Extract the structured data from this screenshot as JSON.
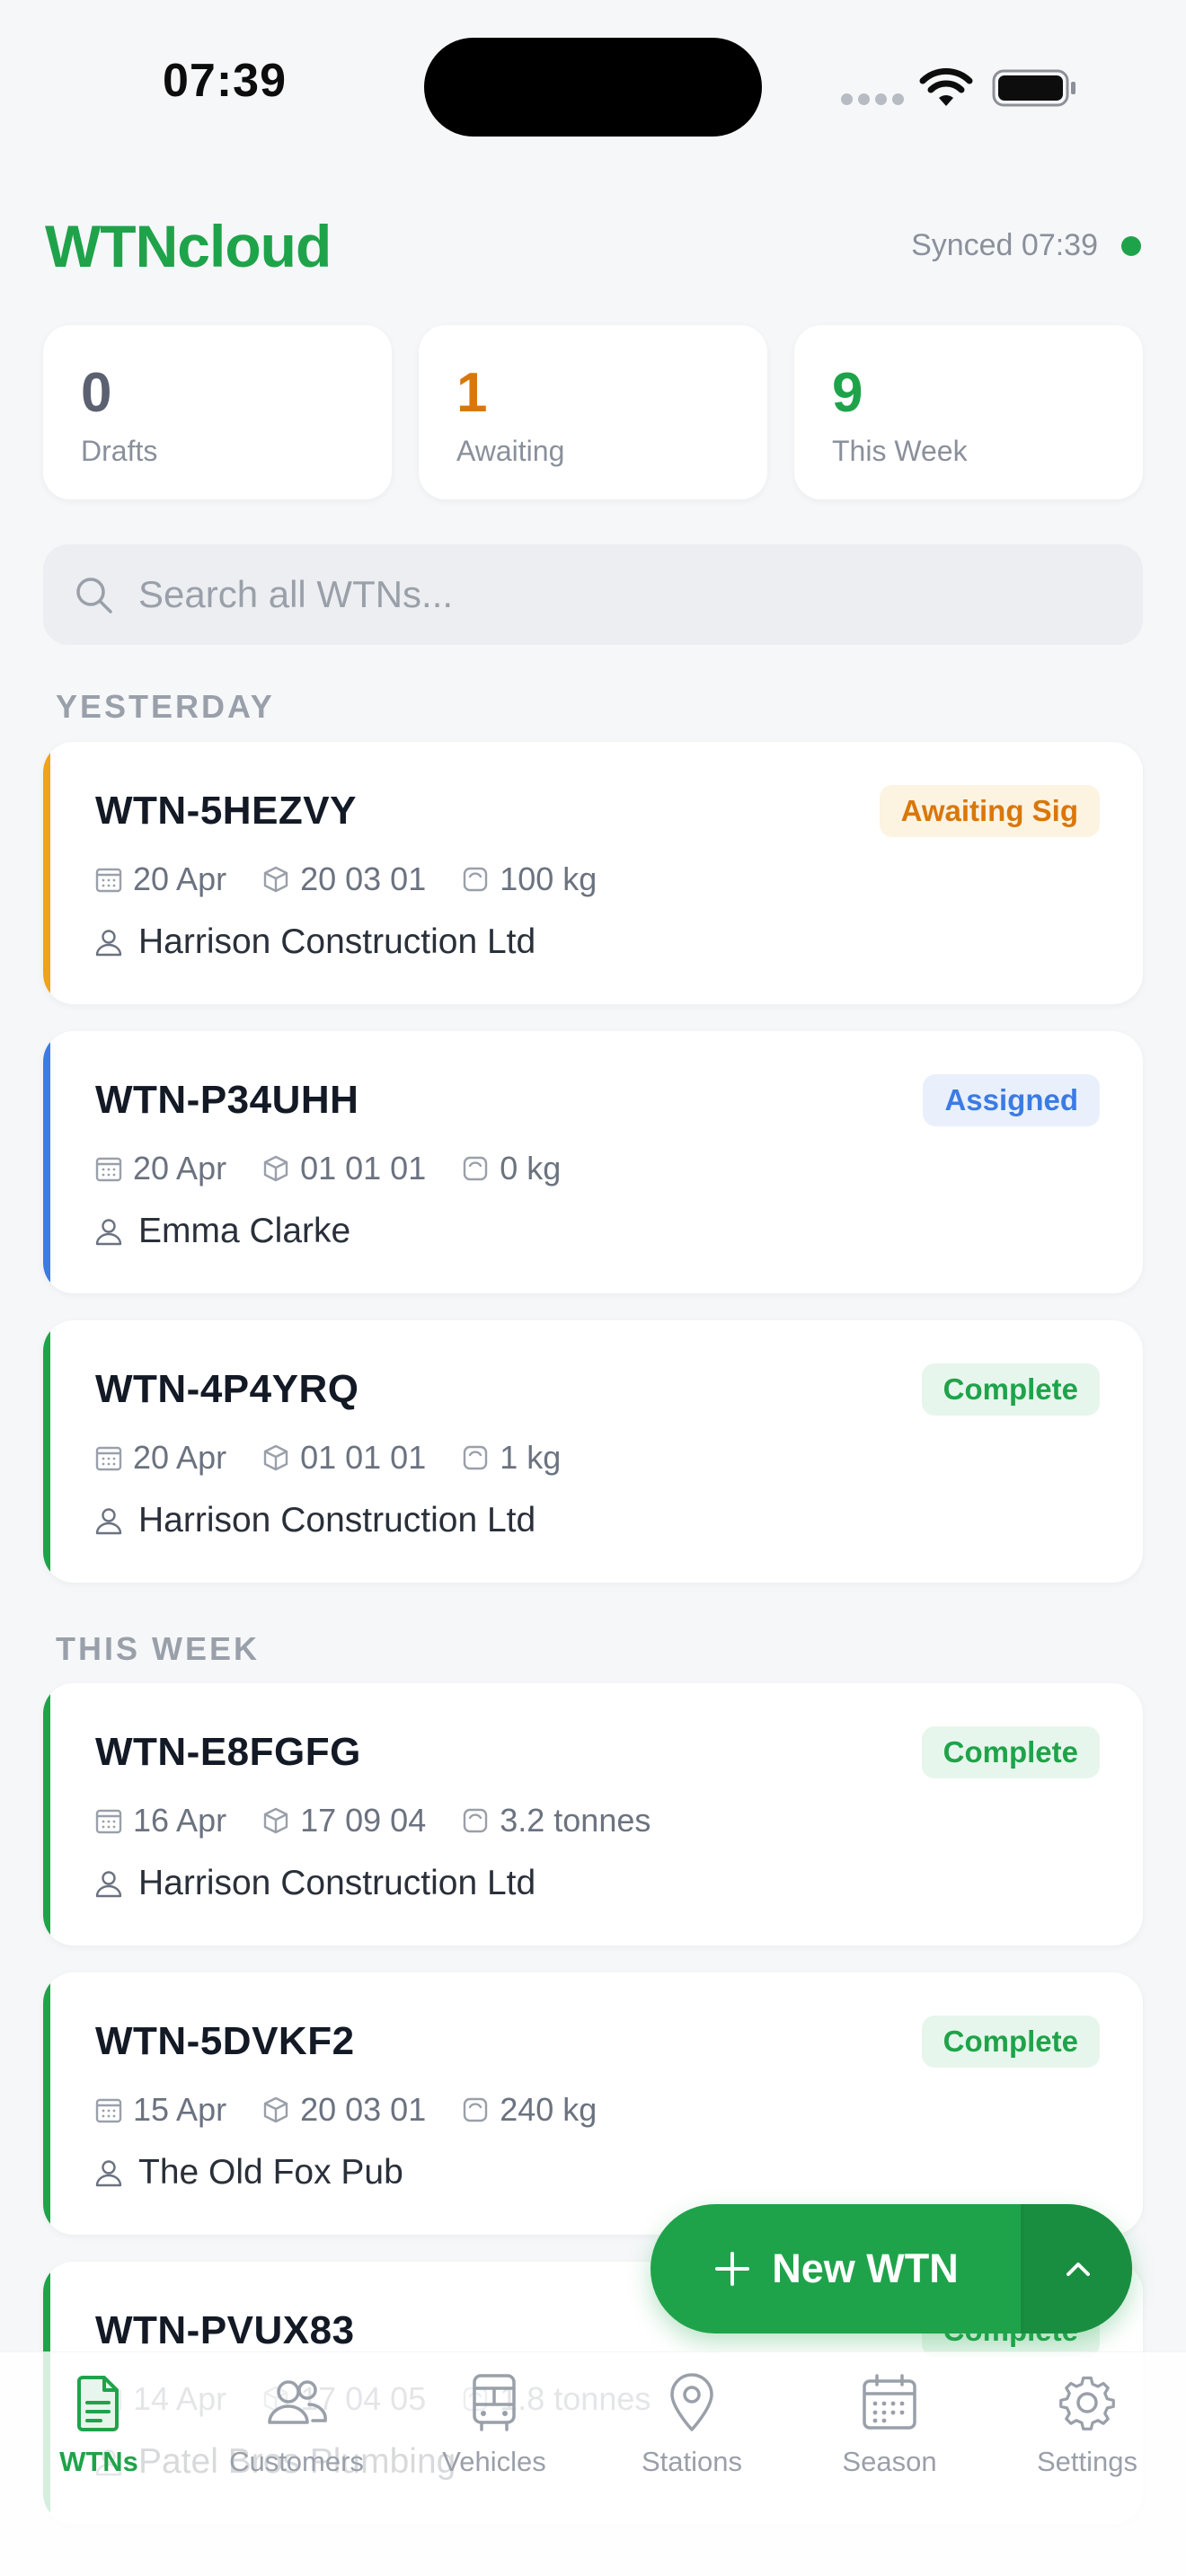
{
  "status_bar": {
    "time": "07:39"
  },
  "header": {
    "title": "WTNcloud",
    "sync_text": "Synced 07:39",
    "brand_color": "#1fa34a"
  },
  "stats": [
    {
      "value": "0",
      "label": "Drafts",
      "color": "#5b6170"
    },
    {
      "value": "1",
      "label": "Awaiting",
      "color": "#d9770b"
    },
    {
      "value": "9",
      "label": "This Week",
      "color": "#1fa34a"
    }
  ],
  "search": {
    "placeholder": "Search all WTNs...",
    "value": ""
  },
  "sections": [
    {
      "title": "YESTERDAY",
      "items": [
        {
          "id": "WTN-5HEZVY",
          "status": "Awaiting Sig",
          "status_kind": "awaiting",
          "date": "20 Apr",
          "code": "20 03 01",
          "weight": "100 kg",
          "customer": "Harrison Construction Ltd"
        },
        {
          "id": "WTN-P34UHH",
          "status": "Assigned",
          "status_kind": "assigned",
          "date": "20 Apr",
          "code": "01 01 01",
          "weight": "0 kg",
          "customer": "Emma Clarke"
        },
        {
          "id": "WTN-4P4YRQ",
          "status": "Complete",
          "status_kind": "complete",
          "date": "20 Apr",
          "code": "01 01 01",
          "weight": "1 kg",
          "customer": "Harrison Construction Ltd"
        }
      ]
    },
    {
      "title": "THIS WEEK",
      "items": [
        {
          "id": "WTN-E8FGFG",
          "status": "Complete",
          "status_kind": "complete",
          "date": "16 Apr",
          "code": "17 09 04",
          "weight": "3.2 tonnes",
          "customer": "Harrison Construction Ltd"
        },
        {
          "id": "WTN-5DVKF2",
          "status": "Complete",
          "status_kind": "complete",
          "date": "15 Apr",
          "code": "20 03 01",
          "weight": "240 kg",
          "customer": "The Old Fox Pub"
        },
        {
          "id": "WTN-PVUX83",
          "status": "Complete",
          "status_kind": "complete",
          "date": "14 Apr",
          "code": "17 04 05",
          "weight": "1.8 tonnes",
          "customer": "Patel Bros Plumbing"
        }
      ]
    }
  ],
  "status_colors": {
    "awaiting": {
      "accent": "#f0a21a",
      "text": "#d9770b",
      "bg": "#fdf3e1"
    },
    "assigned": {
      "accent": "#3b7be3",
      "text": "#3b7be3",
      "bg": "#e9f0fc"
    },
    "complete": {
      "accent": "#1fa34a",
      "text": "#1fa34a",
      "bg": "#e7f6ec"
    }
  },
  "fab": {
    "label": "New WTN"
  },
  "tabs": [
    {
      "label": "WTNs",
      "icon": "document-icon",
      "active": true
    },
    {
      "label": "Customers",
      "icon": "users-icon",
      "active": false
    },
    {
      "label": "Vehicles",
      "icon": "bus-icon",
      "active": false
    },
    {
      "label": "Stations",
      "icon": "map-pin-icon",
      "active": false
    },
    {
      "label": "Season",
      "icon": "calendar-icon",
      "active": false
    },
    {
      "label": "Settings",
      "icon": "gear-icon",
      "active": false
    }
  ]
}
